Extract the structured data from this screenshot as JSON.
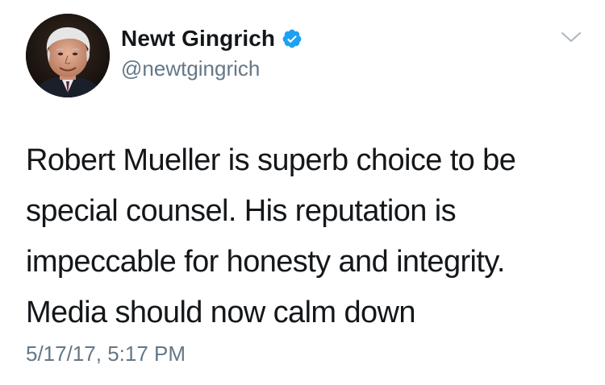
{
  "tweet": {
    "author": {
      "display_name": "Newt Gingrich",
      "handle": "@newtgingrich",
      "verified": true,
      "avatar_icon": "avatar-photo"
    },
    "text_lines": [
      "Robert Mueller is superb choice to be",
      "special counsel. His reputation is",
      "impeccable for honesty and integrity.",
      "Media should now calm down"
    ],
    "timestamp": "5/17/17, 5:17 PM",
    "menu_icon": "chevron-down-icon"
  },
  "colors": {
    "primary_text": "#14171a",
    "secondary_text": "#657786",
    "verified_blue": "#1da1f2",
    "background": "#ffffff"
  }
}
